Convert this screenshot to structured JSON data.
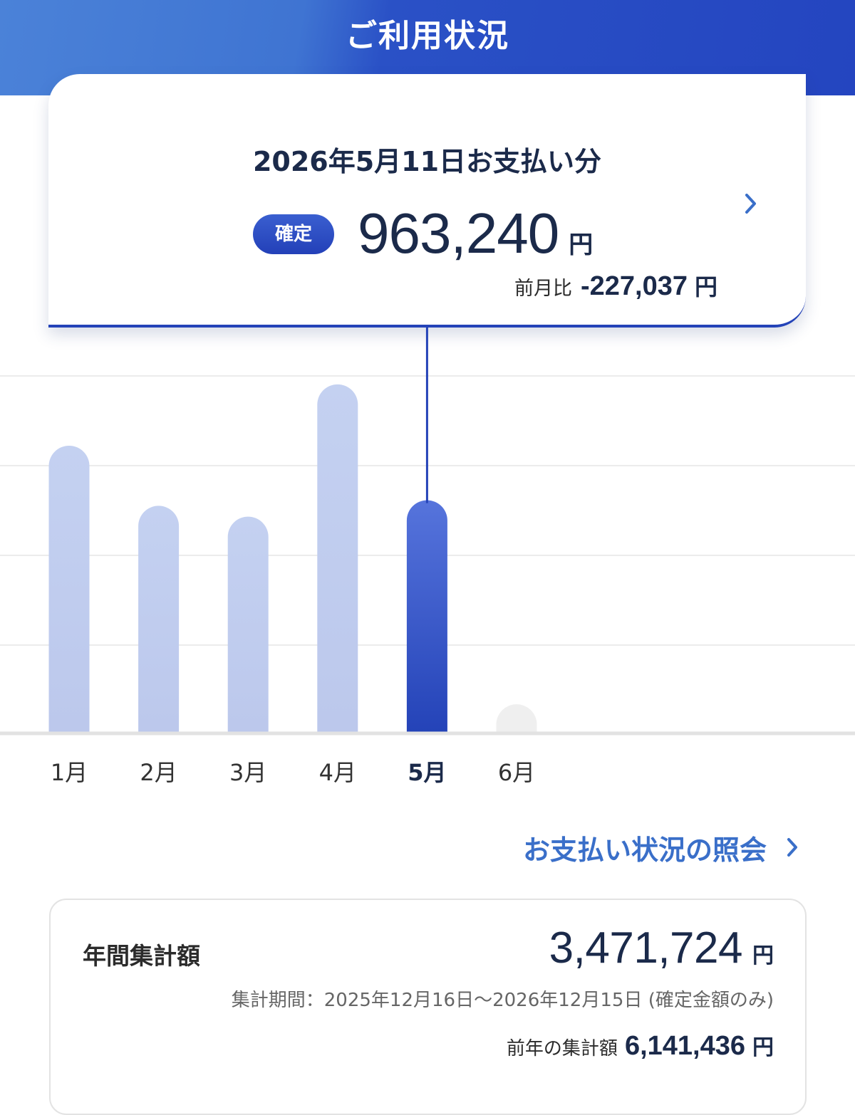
{
  "header": {
    "title": "ご利用状況"
  },
  "summary": {
    "payment_date": "2026年5月11日お支払い分",
    "status": "確定",
    "amount": "963,240",
    "unit": "円",
    "mom_label": "前月比",
    "mom_value": "-227,037",
    "mom_unit": "円"
  },
  "chart_data": {
    "type": "bar",
    "categories": [
      "1月",
      "2月",
      "3月",
      "4月",
      "5月",
      "6月"
    ],
    "values": [
      1190000,
      940000,
      895000,
      1445000,
      963240,
      115000
    ],
    "selected_index": 4,
    "ylim": [
      0,
      1480000
    ],
    "grid": true,
    "title": "",
    "xlabel": "",
    "ylabel": ""
  },
  "colors": {
    "accent": "#2443b8",
    "bar_inactive": "#c4d1f1",
    "bar_future": "#efefef",
    "link": "#3a6fc9"
  },
  "links": {
    "history": "お支払い状況の照会"
  },
  "annual": {
    "label": "年間集計額",
    "amount": "3,471,724",
    "unit": "円",
    "period": "集計期間：2025年12月16日〜2026年12月15日 (確定金額のみ)",
    "prev_label": "前年の集計額",
    "prev_value": "6,141,436",
    "prev_unit": "円"
  }
}
